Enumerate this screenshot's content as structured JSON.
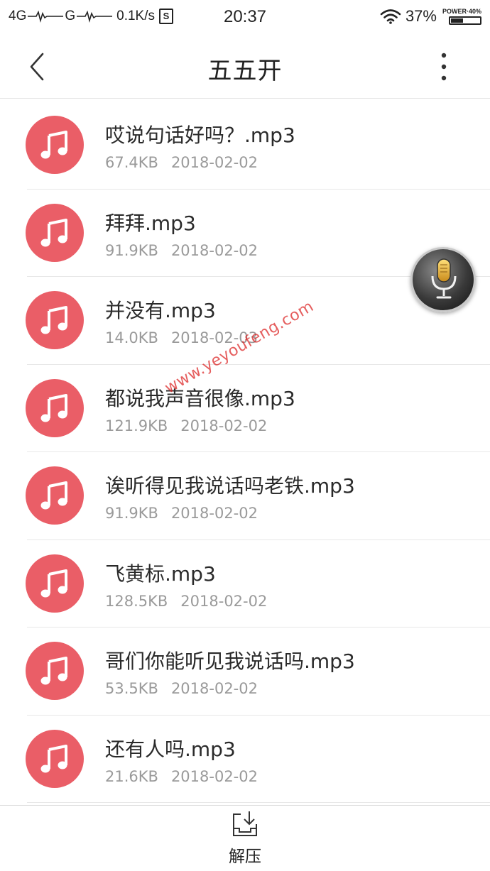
{
  "status_bar": {
    "signal_1": "4G",
    "signal_2": "G",
    "speed": "0.1K/s",
    "sim_badge": "S",
    "time": "20:37",
    "battery_percent": "37%",
    "battery_label": "POWER·40%",
    "battery_level": 0.4
  },
  "header": {
    "title": "五五开",
    "back_icon": "chevron-left-icon",
    "more_icon": "more-vertical-icon"
  },
  "files": [
    {
      "name": "哎说句话好吗？.mp3",
      "size": "67.4KB",
      "date": "2018-02-02"
    },
    {
      "name": "拜拜.mp3",
      "size": "91.9KB",
      "date": "2018-02-02"
    },
    {
      "name": "并没有.mp3",
      "size": "14.0KB",
      "date": "2018-02-03"
    },
    {
      "name": "都说我声音很像.mp3",
      "size": "121.9KB",
      "date": "2018-02-02"
    },
    {
      "name": "诶听得见我说话吗老铁.mp3",
      "size": "91.9KB",
      "date": "2018-02-02"
    },
    {
      "name": "飞黄标.mp3",
      "size": "128.5KB",
      "date": "2018-02-02"
    },
    {
      "name": "哥们你能听见我说话吗.mp3",
      "size": "53.5KB",
      "date": "2018-02-02"
    },
    {
      "name": "还有人吗.mp3",
      "size": "21.6KB",
      "date": "2018-02-02"
    }
  ],
  "file_icon": "music-note-icon",
  "watermark": "www.yeyoufeng.com",
  "bottom": {
    "extract_label": "解压",
    "extract_icon": "extract-icon"
  },
  "colors": {
    "accent": "#ea5e67",
    "meta_text": "#9a9a9a",
    "watermark": "#dc2828"
  }
}
